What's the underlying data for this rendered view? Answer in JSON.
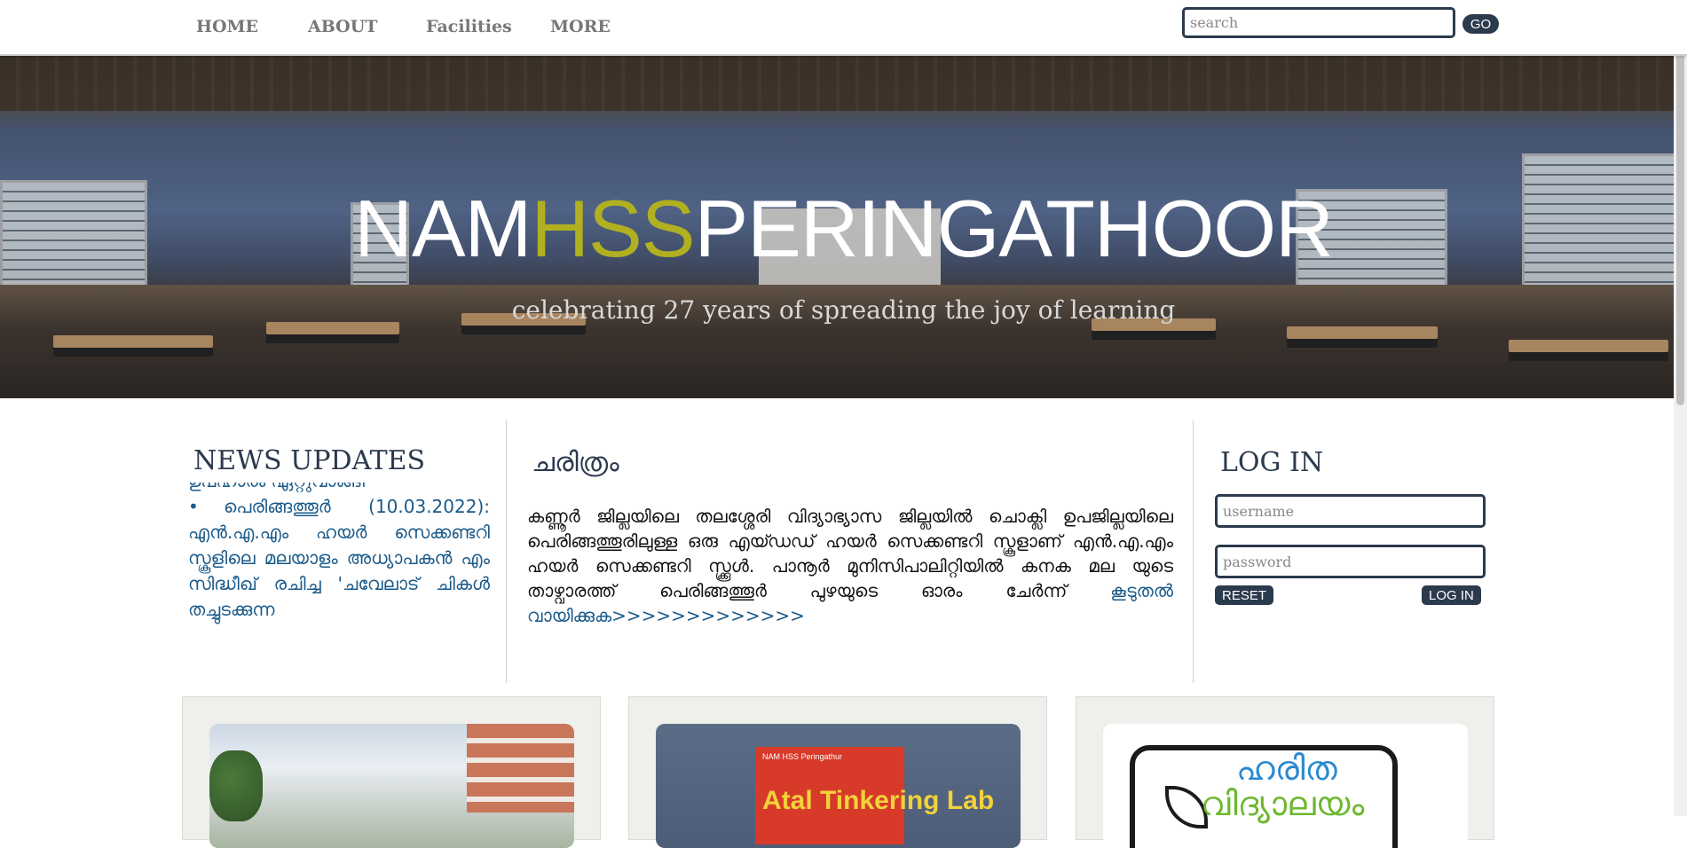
{
  "nav": {
    "items": [
      {
        "label": "HOME"
      },
      {
        "label": "ABOUT"
      },
      {
        "label": "Facilities"
      },
      {
        "label": "MORE"
      }
    ],
    "search": {
      "placeholder": "search",
      "button_label": "GO"
    }
  },
  "hero": {
    "title_part1": "NAM",
    "title_accent": "HSS",
    "title_part2": "PERINGATHOOR",
    "subtitle": "celebrating 27 years of spreading the joy of learning",
    "accent_color": "#b0b020"
  },
  "news": {
    "heading": "NEWS UPDATES",
    "items": [
      {
        "text": "ഉപഹാരം ഏറ്റുവാങ്ങി",
        "bulleted": false
      },
      {
        "text": "പെരിങ്ങത്തൂർ (10.03.2022): എൻ.എ.എം ഹയർ സെക്കണ്ടറി സ്കൂളിലെ മലയാളം അധ്യാപകൻ എം സിദ്ധീഖ് രചിച്ച 'ചവേലാട് ചികൾ തച്ചുടക്കുന്ന",
        "bulleted": true
      }
    ]
  },
  "history": {
    "heading": "ചരിത്രം",
    "body": "കണ്ണൂർ ജില്ലയിലെ തലശ്ശേരി വിദ്യാഭ്യാസ ജില്ലയിൽ ചൊക്ലി ഉപജില്ലയിലെ പെരിങ്ങത്തൂരിലുള്ള ഒരു എയ്ഡഡ് ഹയർ സെക്കണ്ടറി സ്കൂളാണ് എൻ.എ.എം ഹയർ സെക്കണ്ടറി സ്ക്കൂൾ. പാനൂർ മുനിസിപാലിറ്റിയിൽ കനക മല യുടെ താഴ്വാരത്ത് പെരിങ്ങത്തൂർ പുഴയുടെ ഓരം ചേർന്ന് ",
    "read_more": "കൂടുതൽ വായിക്കുക>>>>>>>>>>>>>"
  },
  "login": {
    "heading": "LOG IN",
    "username_placeholder": "username",
    "password_placeholder": "password",
    "reset_label": "RESET",
    "login_label": "LOG IN"
  },
  "cards": {
    "card2_sign_small": "NAM HSS Peringathur",
    "card2_sign_big": "Atal Tinkering Lab",
    "card3_line1": "ഹരിത",
    "card3_line2": "വിദ്യാലയം"
  },
  "colors": {
    "primary_dark": "#2b3a4d",
    "link_blue": "#1a5a8a",
    "nav_gray": "#777777"
  }
}
